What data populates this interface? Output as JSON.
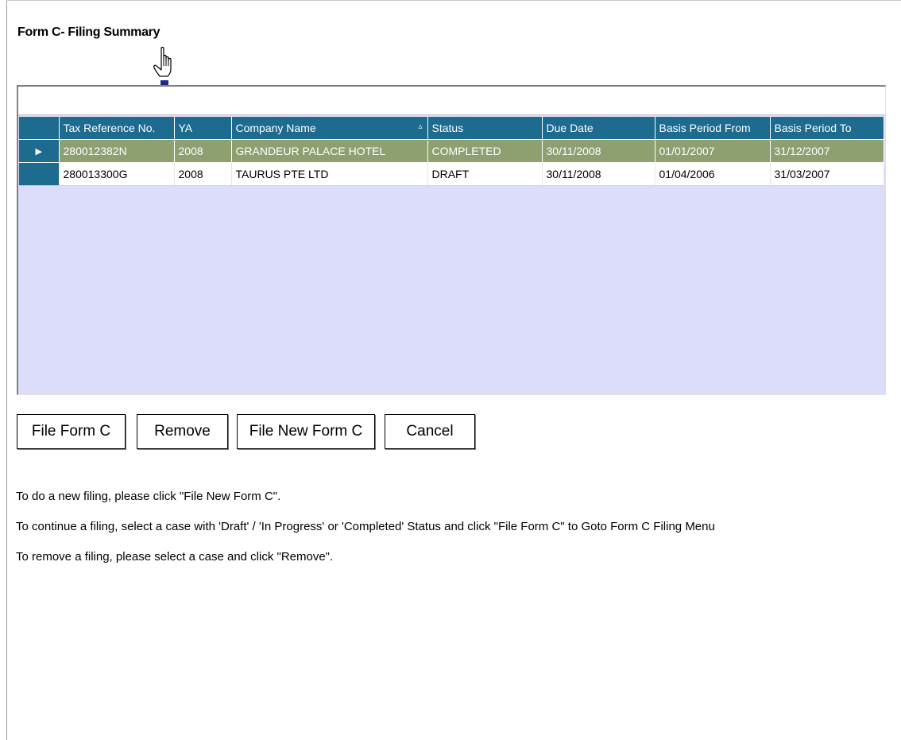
{
  "page": {
    "title": "Form C- Filing Summary"
  },
  "grid": {
    "columns": [
      "Tax Reference No.",
      "YA",
      "Company Name",
      "Status",
      "Due Date",
      "Basis Period From",
      "Basis Period To"
    ],
    "sort_indicator": "▵",
    "rows": [
      [
        "280012382N",
        "2008",
        "GRANDEUR PALACE HOTEL",
        "COMPLETED",
        "30/11/2008",
        "01/01/2007",
        "31/12/2007"
      ],
      [
        "280013300G",
        "2008",
        "TAURUS PTE LTD",
        "DRAFT",
        "30/11/2008",
        "01/04/2006",
        "31/03/2007"
      ]
    ],
    "row_pointer": "▶"
  },
  "buttons": {
    "file_form_c": "File Form C",
    "remove": "Remove",
    "file_new_form_c": "File New Form C",
    "cancel": "Cancel"
  },
  "instructions": {
    "line1": "To do a new filing, please click \"File New Form C\".",
    "line2": "To continue a filing, select a case with 'Draft' / 'In Progress' or 'Completed' Status and click \"File Form C\"  to Goto Form C Filing Menu",
    "line3": "To remove a filing, please select a case and click \"Remove\"."
  },
  "colors": {
    "header_bg": "#1d6b8f",
    "selected_row_bg": "#8ea070",
    "grid_empty_bg": "#dcdcfb"
  },
  "icons": {
    "cursor": "hand-pointer-icon"
  }
}
